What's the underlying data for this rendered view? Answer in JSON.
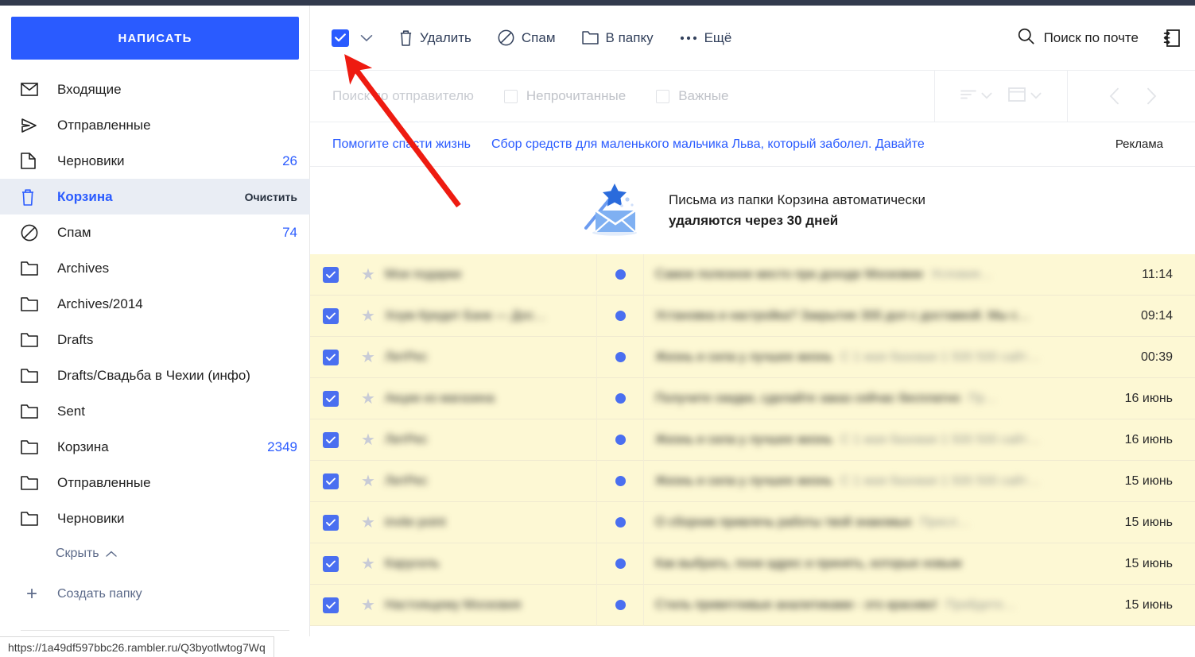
{
  "sidebar": {
    "compose_label": "НАПИСАТЬ",
    "items": [
      {
        "icon": "envelope-icon",
        "label": "Входящие",
        "count": "",
        "action": ""
      },
      {
        "icon": "paper-plane-icon",
        "label": "Отправленные",
        "count": "",
        "action": ""
      },
      {
        "icon": "document-icon",
        "label": "Черновики",
        "count": "26",
        "action": ""
      },
      {
        "icon": "trash-icon",
        "label": "Корзина",
        "count": "",
        "action": "Очистить",
        "selected": true
      },
      {
        "icon": "ban-icon",
        "label": "Спам",
        "count": "74",
        "action": ""
      },
      {
        "icon": "folder-icon",
        "label": "Archives",
        "count": "",
        "action": ""
      },
      {
        "icon": "folder-icon",
        "label": "Archives/2014",
        "count": "",
        "action": ""
      },
      {
        "icon": "folder-icon",
        "label": "Drafts",
        "count": "",
        "action": ""
      },
      {
        "icon": "folder-icon",
        "label": "Drafts/Свадьба в Чехии (инфо)",
        "count": "",
        "action": ""
      },
      {
        "icon": "folder-icon",
        "label": "Sent",
        "count": "",
        "action": ""
      },
      {
        "icon": "folder-icon",
        "label": "Корзина",
        "count": "2349",
        "action": ""
      },
      {
        "icon": "folder-icon",
        "label": "Отправленные",
        "count": "",
        "action": ""
      },
      {
        "icon": "folder-icon",
        "label": "Черновики",
        "count": "",
        "action": ""
      }
    ],
    "hide_label": "Скрыть",
    "create_folder_label": "Создать папку"
  },
  "toolbar": {
    "select_all_checked": true,
    "delete_label": "Удалить",
    "spam_label": "Спам",
    "move_label": "В папку",
    "more_label": "Ещё",
    "search_label": "Поиск по почте",
    "contacts_icon": "contacts-book-icon"
  },
  "filterbar": {
    "sender_placeholder": "Поиск по отправителю",
    "unread_label": "Непрочитанные",
    "important_label": "Важные",
    "sort_icon": "sort-icon",
    "layout_icon": "layout-icon",
    "prev_icon": "chevron-left-icon",
    "next_icon": "chevron-right-icon"
  },
  "ad": {
    "title": "Помогите спасти жизнь",
    "text": "Сбор средств для маленького мальчика Льва, который заболел. Давайте",
    "label": "Реклама"
  },
  "info": {
    "line1": "Письма из папки Корзина автоматически",
    "line2": "удаляются через 30 дней",
    "icon": "magic-wand-envelope-icon"
  },
  "list": {
    "rows": [
      {
        "checked": true,
        "starred": false,
        "unread": true,
        "sender": "Мои подарки",
        "subject": "Самое полезное место при доходе Московии",
        "preview": "Условия…",
        "time": "11:14"
      },
      {
        "checked": true,
        "starred": false,
        "unread": true,
        "sender": "Хоум Кредит Банк — Дос…",
        "subject": "Установка и настройка? Закрытие 300 дол с доставкой. Мы с…",
        "preview": "",
        "time": "09:14"
      },
      {
        "checked": true,
        "starred": false,
        "unread": true,
        "sender": "ЛитРес",
        "subject": "Жизнь и сила у лучшее жизнь",
        "preview": "С 1 мая базовая 1 500 500 сайт…",
        "time": "00:39"
      },
      {
        "checked": true,
        "starred": false,
        "unread": true,
        "sender": "Акции из магазина",
        "subject": "Получите скидки, сделайте заказ сейчас бесплатно",
        "preview": "Пр…",
        "time": "16 июнь"
      },
      {
        "checked": true,
        "starred": false,
        "unread": true,
        "sender": "ЛитРес",
        "subject": "Жизнь и сила у лучшее жизнь",
        "preview": "С 1 мая базовая 1 500 500 сайт…",
        "time": "16 июнь"
      },
      {
        "checked": true,
        "starred": false,
        "unread": true,
        "sender": "ЛитРес",
        "subject": "Жизнь и сила у лучшее жизнь",
        "preview": "С 1 мая базовая 1 500 500 сайт…",
        "time": "15 июнь"
      },
      {
        "checked": true,
        "starred": false,
        "unread": true,
        "sender": "invite point",
        "subject": "О сборник привлечь работы твой знакомых",
        "preview": "Присл…",
        "time": "15 июнь"
      },
      {
        "checked": true,
        "starred": false,
        "unread": true,
        "sender": "Карусель",
        "subject": "Как выбрать, пони адрес и принять, которые новым",
        "preview": "",
        "time": "15 июнь"
      },
      {
        "checked": true,
        "starred": false,
        "unread": true,
        "sender": "Настоящему Московия",
        "subject": "Стиль приветливые аналитиками - это красиво!",
        "preview": "Прийдите…",
        "time": "15 июнь"
      }
    ]
  },
  "statusbar": {
    "url": "https://1a49df597bbc26.rambler.ru/Q3byotlwtog7Wq"
  },
  "colors": {
    "accent_blue": "#2a5bff",
    "row_yellow": "#fdf8d4",
    "selected_sidebar": "#e9edf4",
    "arrow_red": "#ee1b11",
    "top_strip": "#323a4d"
  }
}
